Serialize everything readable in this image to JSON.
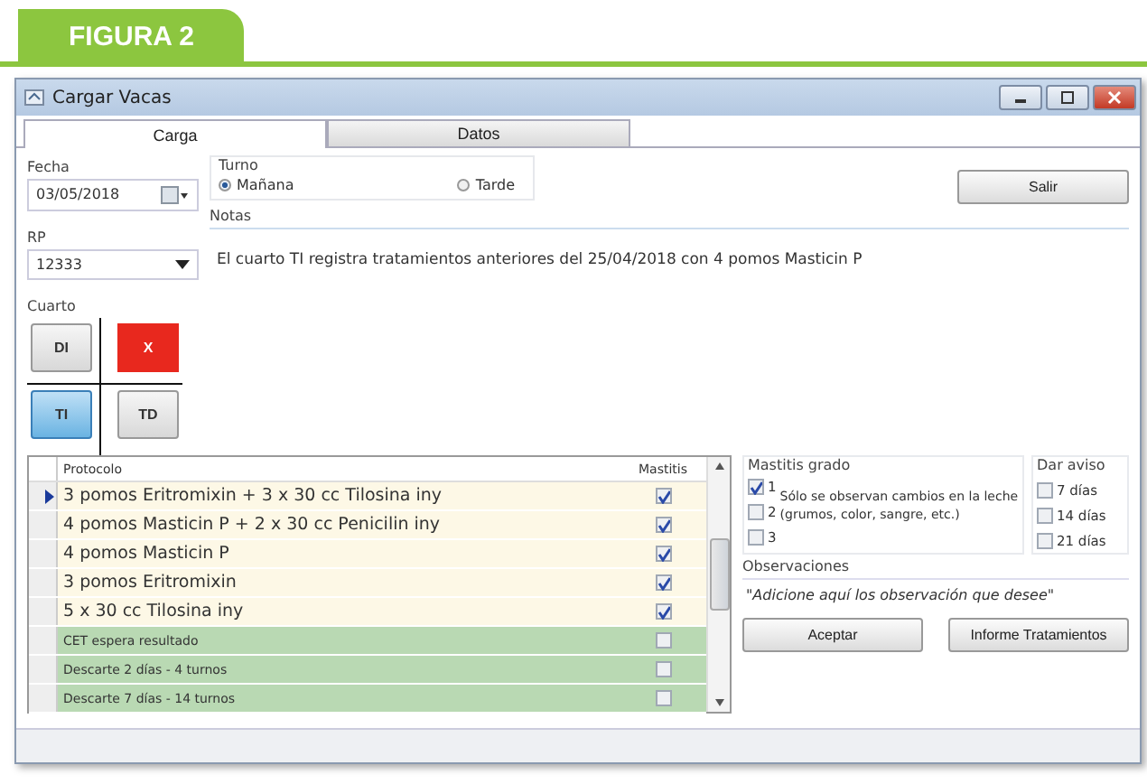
{
  "figure_label": "FIGURA 2",
  "window": {
    "title": "Cargar Vacas"
  },
  "tabs": [
    {
      "label": "Carga",
      "selected": true
    },
    {
      "label": "Datos",
      "selected": false
    }
  ],
  "fecha": {
    "label": "Fecha",
    "value": "03/05/2018"
  },
  "rp": {
    "label": "RP",
    "value": "12333"
  },
  "cuarto": {
    "label": "Cuarto",
    "buttons": [
      {
        "label": "DI",
        "selected": false,
        "marked": false
      },
      {
        "label": "X",
        "selected": false,
        "marked": true
      },
      {
        "label": "TI",
        "selected": true,
        "marked": false
      },
      {
        "label": "TD",
        "selected": false,
        "marked": false
      }
    ]
  },
  "turno": {
    "label": "Turno",
    "options": [
      {
        "label": "Mañana",
        "selected": true
      },
      {
        "label": "Tarde",
        "selected": false
      }
    ]
  },
  "salir_button": "Salir",
  "notas": {
    "label": "Notas",
    "value": "El cuarto TI registra tratamientos anteriores del 25/04/2018 con 4 pomos Masticin P"
  },
  "table": {
    "columns": [
      "Protocolo",
      "Mastitis"
    ],
    "rows": [
      {
        "protocolo": "3 pomos Eritromixin + 3 x 30 cc Tilosina iny",
        "mastitis": true,
        "current": true,
        "color": "#fdf8e6"
      },
      {
        "protocolo": "4 pomos Masticin P + 2 x 30 cc Penicilin iny",
        "mastitis": true,
        "current": false,
        "color": "#fdf8e6"
      },
      {
        "protocolo": "4 pomos Masticin P",
        "mastitis": true,
        "current": false,
        "color": "#fdf8e6"
      },
      {
        "protocolo": "3 pomos Eritromixin",
        "mastitis": true,
        "current": false,
        "color": "#fdf8e6"
      },
      {
        "protocolo": "5 x 30 cc Tilosina iny",
        "mastitis": true,
        "current": false,
        "color": "#fdf8e6"
      },
      {
        "protocolo": "CET espera resultado",
        "mastitis": false,
        "current": false,
        "color": "#b9d9b3"
      },
      {
        "protocolo": "Descarte 2 días - 4 turnos",
        "mastitis": false,
        "current": false,
        "color": "#b9d9b3"
      },
      {
        "protocolo": "Descarte 7 días - 14 turnos",
        "mastitis": false,
        "current": false,
        "color": "#b9d9b3"
      }
    ]
  },
  "mastitis_grado": {
    "label": "Mastitis grado",
    "options": [
      {
        "label": "1",
        "checked": true
      },
      {
        "label": "2",
        "checked": false
      },
      {
        "label": "3",
        "checked": false
      }
    ],
    "description": "Sólo se observan cambios en la leche (grumos, color, sangre, etc.)"
  },
  "dar_aviso": {
    "label": "Dar aviso",
    "options": [
      {
        "label": "7 días",
        "checked": false
      },
      {
        "label": "14 días",
        "checked": false
      },
      {
        "label": "21 días",
        "checked": false
      }
    ]
  },
  "observaciones": {
    "label": "Observaciones",
    "value": "\"Adicione aquí los observación que desee\""
  },
  "buttons": [
    "Aceptar",
    "Informe Tratamientos"
  ]
}
